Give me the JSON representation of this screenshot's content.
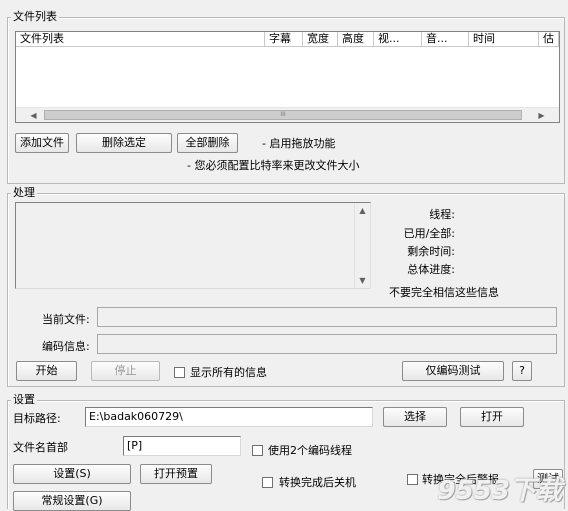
{
  "file_list": {
    "group_title": "文件列表",
    "columns": [
      "文件列表",
      "字幕",
      "宽度",
      "高度",
      "视...",
      "音...",
      "时间",
      "估"
    ],
    "scroll_left": "◀",
    "scroll_right": "▶",
    "scroll_grip": "III",
    "add_button": "添加文件",
    "remove_selected_button": "删除选定",
    "remove_all_button": "全部删除",
    "drag_drop_note": "- 启用拖放功能",
    "bitrate_note": "- 您必须配置比特率来更改文件大小"
  },
  "process": {
    "group_title": "处理",
    "labels": {
      "thread": "线程:",
      "used_total": "已用/全部:",
      "remaining": "剩余时间:",
      "overall": "总体进度:"
    },
    "disclaimer": "不要完全相信这些信息",
    "current_file_label": "当前文件:",
    "current_file_value": "",
    "encode_info_label": "编码信息:",
    "encode_info_value": "",
    "start_button": "开始",
    "stop_button": "停止",
    "show_all_info": "显示所有的信息",
    "encode_test_button": "仅编码测试",
    "help_button": "?"
  },
  "settings": {
    "group_title": "设置",
    "target_path_label": "目标路径:",
    "target_path_value": "E:\\badak060729\\",
    "browse_button": "选择",
    "open_button": "打开",
    "filename_prefix_label": "文件名首部",
    "filename_prefix_value": "[P]",
    "two_threads": "使用2个编码线程",
    "settings_button": "设置(S)",
    "open_preset_button": "打开预置",
    "shutdown_after": "转换完成后关机",
    "alarm_after": "转换完全后警报",
    "test_button": "测试",
    "general_settings_button": "常规设置(G)"
  },
  "watermark": "9553下载"
}
